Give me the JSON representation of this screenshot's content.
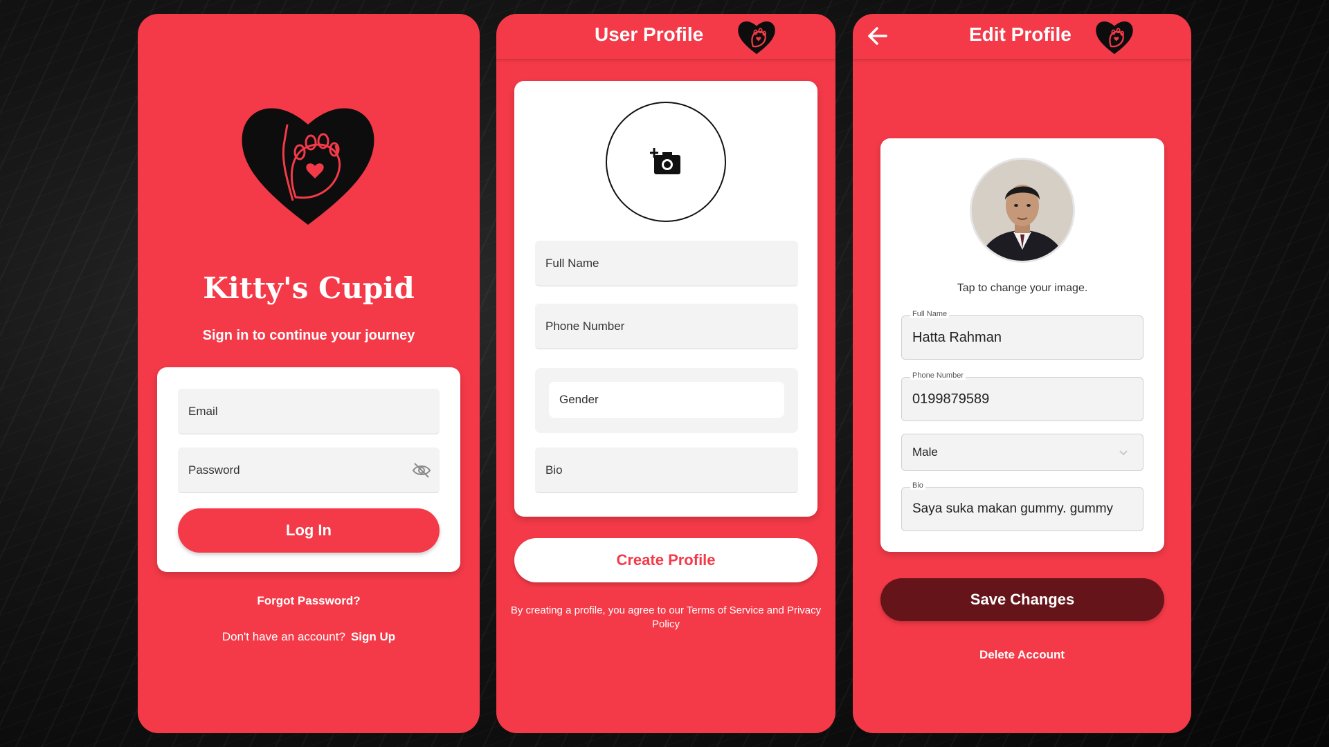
{
  "login": {
    "app_title": "Kitty's Cupid",
    "subtitle": "Sign in to continue your journey",
    "email_placeholder": "Email",
    "password_placeholder": "Password",
    "login_label": "Log In",
    "forgot_label": "Forgot Password?",
    "no_account_text": "Don't have an account?",
    "signup_label": "Sign Up"
  },
  "create_profile": {
    "header_title": "User Profile",
    "full_name_placeholder": "Full Name",
    "phone_placeholder": "Phone Number",
    "gender_placeholder": "Gender",
    "bio_placeholder": "Bio",
    "create_label": "Create Profile",
    "terms_text": "By creating a profile, you agree to our Terms of Service and Privacy Policy"
  },
  "edit_profile": {
    "header_title": "Edit Profile",
    "tap_text": "Tap to change your image.",
    "full_name_label": "Full Name",
    "full_name_value": "Hatta Rahman",
    "phone_label": "Phone Number",
    "phone_value": "0199879589",
    "gender_value": "Male",
    "bio_label": "Bio",
    "bio_value": "Saya suka makan gummy. gummy",
    "save_label": "Save Changes",
    "delete_label": "Delete Account"
  },
  "icons": {
    "logo": "heart-paw-icon",
    "eye": "eye-off-icon",
    "camera": "add-photo-icon",
    "back": "arrow-left-icon",
    "chevron": "chevron-down-icon"
  },
  "colors": {
    "primary": "#f43a48",
    "dark_button": "#65141a",
    "card": "#ffffff"
  }
}
